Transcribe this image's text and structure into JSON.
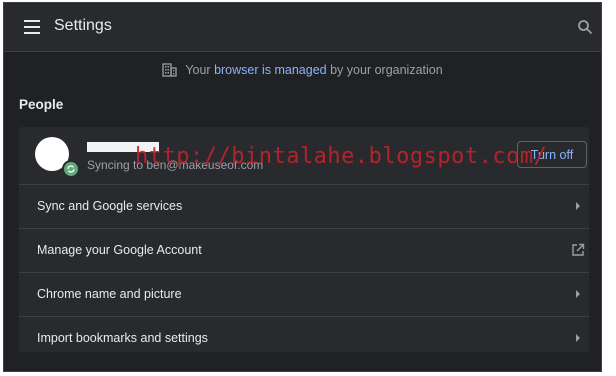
{
  "header": {
    "title": "Settings",
    "menu_icon": "hamburger-menu-icon",
    "search_icon": "search-icon"
  },
  "managed_notice": {
    "prefix": "Your",
    "link": "browser is managed",
    "suffix": "by your organization",
    "icon": "building-icon"
  },
  "people": {
    "heading": "People",
    "profile": {
      "name": "",
      "sync_status": "Syncing to ben@makeuseof.com",
      "turn_off_label": "Turn off"
    },
    "rows": [
      {
        "label": "Sync and Google services",
        "icon": "chevron-right-icon"
      },
      {
        "label": "Manage your Google Account",
        "icon": "open-in-new-icon"
      },
      {
        "label": "Chrome name and picture",
        "icon": "chevron-right-icon"
      },
      {
        "label": "Import bookmarks and settings",
        "icon": "chevron-right-icon"
      }
    ]
  },
  "watermark": "http://bintalahe.blogspot.com/",
  "colors": {
    "background": "#202124",
    "card": "#292a2d",
    "link": "#8ab4f8",
    "text": "#e8eaed",
    "watermark": "#c0242c"
  }
}
